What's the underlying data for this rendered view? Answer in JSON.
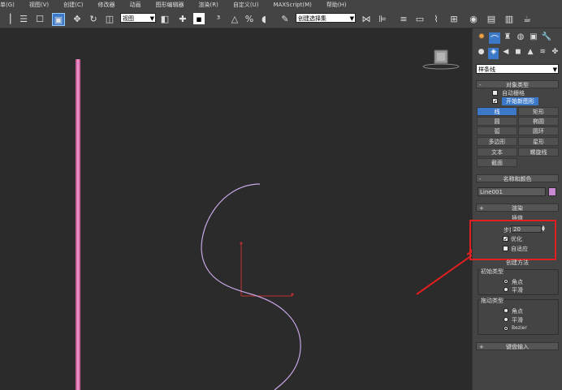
{
  "menu": [
    "单(G)",
    "视图(V)",
    "创建(C)",
    "修改器",
    "动画",
    "图形编辑器",
    "渲染(R)",
    "自定义(U)",
    "MAXScript(M)",
    "帮助(H)"
  ],
  "toolbar": {
    "view_dropdown": "视图",
    "selection_set_dropdown": "创建选择集"
  },
  "panel": {
    "category_dropdown": "样条线",
    "object_type": {
      "header": "对象类型",
      "auto_grid": "自动栅格",
      "start_new_shape": "开始新图形",
      "buttons": [
        "线",
        "矩形",
        "圆",
        "椭圆",
        "弧",
        "圆环",
        "多边形",
        "星形",
        "文本",
        "螺旋线",
        "截面"
      ]
    },
    "name_color": {
      "header": "名称和颜色",
      "name_value": "Line001",
      "color": "#c889d2"
    },
    "rendering": {
      "header": "渲染"
    },
    "interpolation": {
      "header": "插值",
      "steps_label": "步数:",
      "steps_value": "20",
      "optimize": "优化",
      "adaptive": "自适应"
    },
    "creation_method": {
      "header": "创建方法",
      "initial_type": "初始类型",
      "initial_options": [
        "角点",
        "平滑"
      ],
      "drag_type": "拖动类型",
      "drag_options": [
        "角点",
        "平滑",
        "Bezier"
      ]
    },
    "keyboard_entry": {
      "header": "键盘输入"
    }
  },
  "colors": {
    "viewport_bg": "#2b2b2b",
    "spline": "#c8a6e6",
    "pink_line": "#d060a0",
    "annotation_red": "#e02020"
  }
}
